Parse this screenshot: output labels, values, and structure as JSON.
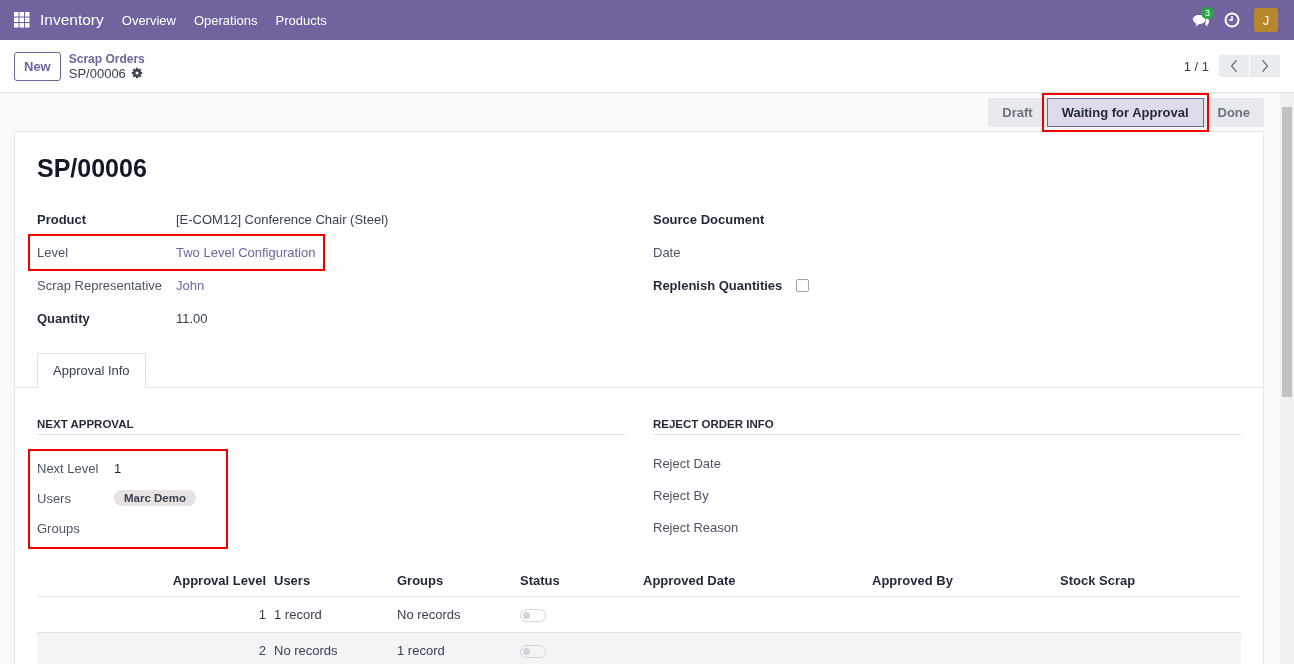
{
  "navbar": {
    "app": "Inventory",
    "menu": [
      "Overview",
      "Operations",
      "Products"
    ],
    "message_count": "3",
    "avatar": "J"
  },
  "control_panel": {
    "new_button": "New",
    "breadcrumb": "Scrap Orders",
    "record": "SP/00006",
    "pager": "1 / 1"
  },
  "status_bar": [
    {
      "label": "Draft",
      "selected": false,
      "highlighted": false
    },
    {
      "label": "Waiting for Approval",
      "selected": true,
      "highlighted": true
    },
    {
      "label": "Done",
      "selected": false,
      "highlighted": false
    }
  ],
  "title": "SP/00006",
  "left_fields": [
    {
      "label": "Product",
      "value": "[E-COM12] Conference Chair (Steel)",
      "required": true,
      "link": false,
      "highlighted": false
    },
    {
      "label": "Level",
      "value": "Two Level Configuration",
      "required": false,
      "link": true,
      "highlighted": true
    },
    {
      "label": "Scrap Representative",
      "value": "John",
      "required": false,
      "link": true,
      "highlighted": false
    },
    {
      "label": "Quantity",
      "value": "11.00",
      "required": true,
      "link": false,
      "highlighted": false
    }
  ],
  "right_fields": [
    {
      "label": "Source Document",
      "kind": "text",
      "required": true
    },
    {
      "label": "Date",
      "kind": "text",
      "required": false
    },
    {
      "label": "Replenish Quantities",
      "kind": "checkbox",
      "required": true,
      "checked": false
    }
  ],
  "tabs": [
    {
      "label": "Approval Info",
      "selected": true
    }
  ],
  "next_approval": {
    "heading": "NEXT APPROVAL",
    "highlighted": true,
    "fields": [
      {
        "label": "Next Level",
        "value": "1",
        "kind": "text"
      },
      {
        "label": "Users",
        "value": "Marc Demo",
        "kind": "tag"
      },
      {
        "label": "Groups",
        "kind": "text"
      }
    ]
  },
  "reject_info": {
    "heading": "REJECT ORDER INFO",
    "fields": [
      "Reject Date",
      "Reject By",
      "Reject Reason"
    ]
  },
  "table": {
    "columns": [
      "Approval Level",
      "Users",
      "Groups",
      "Status",
      "Approved Date",
      "Approved By",
      "Stock Scrap"
    ],
    "rows": [
      {
        "level": "1",
        "users": "1 record",
        "groups": "No records",
        "status": false,
        "hovered": false
      },
      {
        "level": "2",
        "users": "No records",
        "groups": "1 record",
        "status": false,
        "hovered": true
      }
    ]
  }
}
